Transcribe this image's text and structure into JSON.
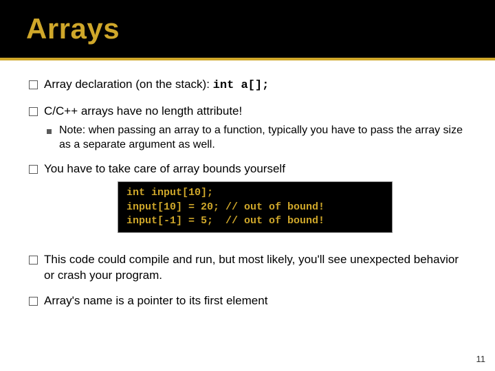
{
  "title": "Arrays",
  "bullets": {
    "b1_prefix": "Array declaration (on the stack): ",
    "b1_code": "int a[];",
    "b2": "C/C++ arrays have no length attribute!",
    "b2_note": "Note: when passing an array to a function, typically you have to pass the array size as a separate argument as well.",
    "b3": "You have to take care of array bounds yourself",
    "b4": "This code could compile and run, but most likely, you'll see unexpected behavior or crash your program.",
    "b5": "Array's name is a pointer to its first element"
  },
  "code_block": "int input[10];\ninput[10] = 20; // out of bound!\ninput[-1] = 5;  // out of bound!",
  "page_number": "11"
}
